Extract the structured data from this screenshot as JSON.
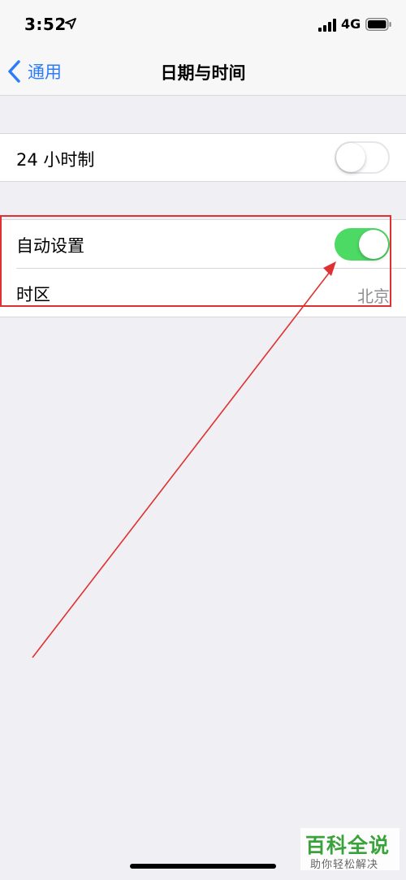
{
  "status_bar": {
    "time": "3:52",
    "network": "4G",
    "icons": [
      "location-arrow-icon",
      "cellular-signal-icon",
      "battery-icon"
    ]
  },
  "nav": {
    "back_label": "通用",
    "title": "日期与时间"
  },
  "settings": {
    "hour24": {
      "label": "24 小时制",
      "enabled": false
    },
    "auto_set": {
      "label": "自动设置",
      "enabled": true
    },
    "timezone": {
      "label": "时区",
      "value": "北京"
    }
  },
  "watermark": {
    "title": "百科全说",
    "subtitle": "助你轻松解决"
  },
  "colors": {
    "accent_blue": "#2b7cf6",
    "toggle_on_green": "#4cd964",
    "annotation_red": "#e03131",
    "background": "#efeff4",
    "watermark_green": "#3aa23a"
  }
}
